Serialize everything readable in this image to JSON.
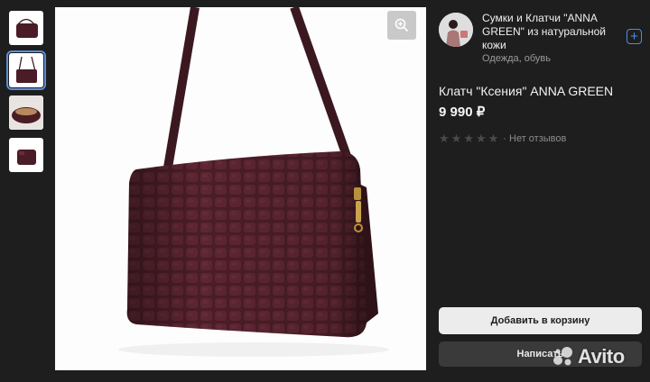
{
  "thumbnails": [
    {
      "icon": "bag-front-photo",
      "active": false
    },
    {
      "icon": "bag-strap-photo",
      "active": true
    },
    {
      "icon": "bag-open-photo",
      "active": false
    },
    {
      "icon": "bag-side-photo",
      "active": false
    }
  ],
  "main_image": {
    "icon": "crocodile-leather-bag-photo"
  },
  "zoom_button": {
    "icon": "zoom-in-icon"
  },
  "shop": {
    "name": "Сумки и Клатчи \"ANNA GREEN\" из натуральной кожи",
    "category": "Одежда, обувь",
    "follow_icon": "plus-icon"
  },
  "product": {
    "title": "Клатч \"Ксения\" ANNA GREEN",
    "price": "9 990 ₽"
  },
  "rating": {
    "stars_filled": 0,
    "stars_total": 5,
    "reviews_text": "· Нет отзывов"
  },
  "actions": {
    "add_to_cart": "Добавить в корзину",
    "write": "Написать"
  },
  "watermark": {
    "text": "Avito"
  },
  "colors": {
    "background": "#1e1e1f",
    "accent": "#4d8fe0",
    "bag": "#4a1c26"
  }
}
